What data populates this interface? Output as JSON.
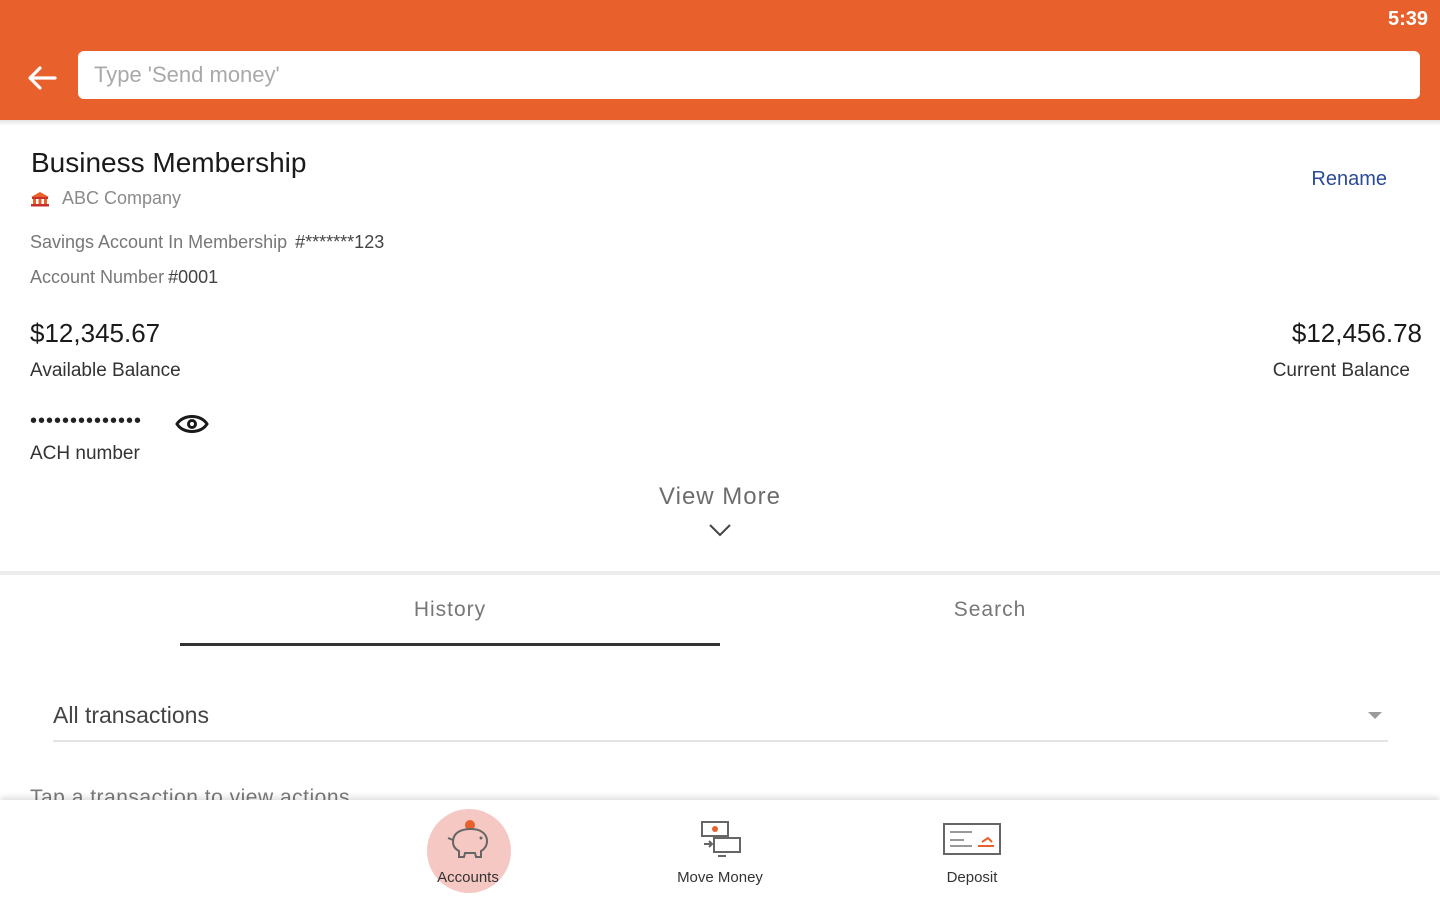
{
  "status_bar": {
    "time": "5:39"
  },
  "search": {
    "placeholder": "Type 'Send money'"
  },
  "account": {
    "title": "Business Membership",
    "company": "ABC Company",
    "rename_label": "Rename",
    "savings_label": "Savings Account In Membership",
    "savings_value": "#*******123",
    "account_number_label": "Account Number",
    "account_number_value": "#0001",
    "available_balance": "$12,345.67",
    "available_label": "Available Balance",
    "current_balance": "$12,456.78",
    "current_label": "Current Balance",
    "ach_masked": "••••••••••••••",
    "ach_label": "ACH number",
    "view_more_label": "View More"
  },
  "tabs": [
    {
      "label": "History",
      "active": true
    },
    {
      "label": "Search",
      "active": false
    }
  ],
  "filter": {
    "selected": "All transactions"
  },
  "hint": "Tap a transaction to view actions",
  "bottom_nav": [
    {
      "label": "Accounts",
      "icon": "piggy-bank-icon",
      "active": true
    },
    {
      "label": "Move Money",
      "icon": "move-money-icon",
      "active": false
    },
    {
      "label": "Deposit",
      "icon": "check-deposit-icon",
      "active": false
    }
  ],
  "colors": {
    "brand": "#e8612c",
    "link": "#2c4a9a",
    "active_bubble": "#f6c8c3"
  }
}
